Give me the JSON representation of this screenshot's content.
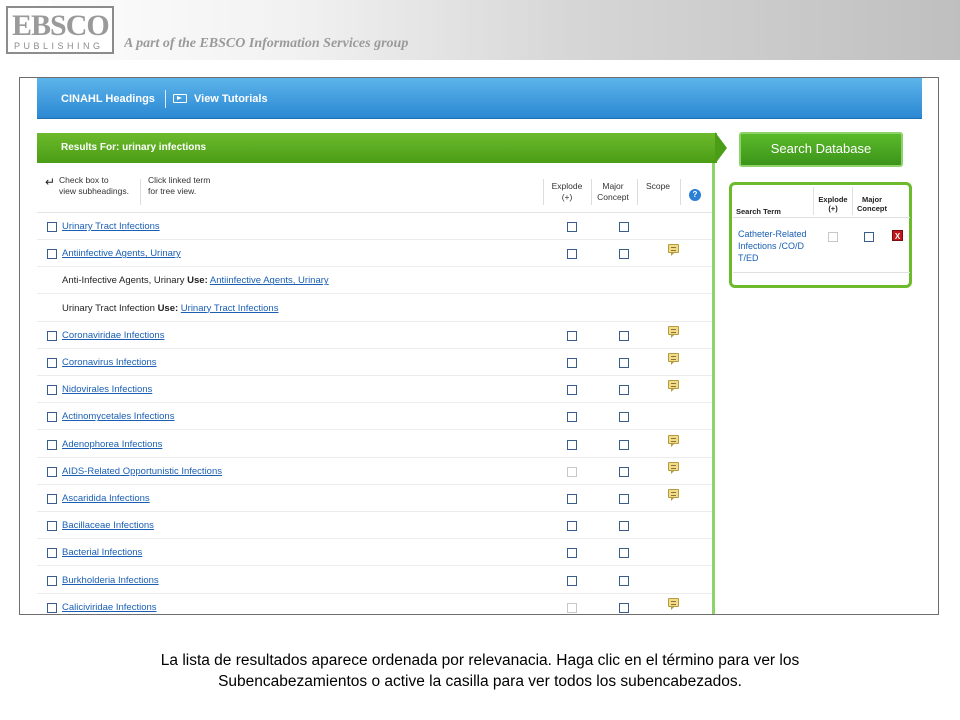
{
  "banner": {
    "logo_main": "EBSCO",
    "logo_sub": "PUBLISHING",
    "tagline": "A part of the EBSCO Information Services group"
  },
  "nav": {
    "headings": "CINAHL Headings",
    "tutorials": "View Tutorials"
  },
  "results": {
    "label": "Results For: urinary infections",
    "hint_checkbox": [
      "Check box to",
      "view subheadings."
    ],
    "hint_click": [
      "Click linked term",
      "for tree view."
    ],
    "col_explode": [
      "Explode",
      "(+)"
    ],
    "col_major": [
      "Major",
      "Concept"
    ],
    "col_scope": "Scope",
    "help": "?",
    "rows": [
      {
        "type": "term",
        "term": "Urinary Tract Infections",
        "scope": false,
        "explode_enabled": true
      },
      {
        "type": "term",
        "term": "Antiinfective Agents, Urinary",
        "scope": true,
        "explode_enabled": true
      },
      {
        "type": "use",
        "text": "Anti-Infective Agents, Urinary",
        "use_label": "Use:",
        "link": "Antiinfective Agents, Urinary"
      },
      {
        "type": "use",
        "text": "Urinary Tract Infection",
        "use_label": "Use:",
        "link": "Urinary Tract Infections"
      },
      {
        "type": "term",
        "term": "Coronaviridae Infections",
        "scope": true,
        "explode_enabled": true
      },
      {
        "type": "term",
        "term": "Coronavirus Infections",
        "scope": true,
        "explode_enabled": true
      },
      {
        "type": "term",
        "term": "Nidovirales Infections",
        "scope": true,
        "explode_enabled": true
      },
      {
        "type": "term",
        "term": "Actinomycetales Infections",
        "scope": false,
        "explode_enabled": true
      },
      {
        "type": "term",
        "term": "Adenophorea Infections",
        "scope": true,
        "explode_enabled": true
      },
      {
        "type": "term",
        "term": "AIDS-Related Opportunistic Infections",
        "scope": true,
        "explode_enabled": false
      },
      {
        "type": "term",
        "term": "Ascaridida Infections",
        "scope": true,
        "explode_enabled": true
      },
      {
        "type": "term",
        "term": "Bacillaceae Infections",
        "scope": false,
        "explode_enabled": true
      },
      {
        "type": "term",
        "term": "Bacterial Infections",
        "scope": false,
        "explode_enabled": true
      },
      {
        "type": "term",
        "term": "Burkholderia Infections",
        "scope": false,
        "explode_enabled": true
      },
      {
        "type": "term",
        "term": "Caliciviridae Infections",
        "scope": true,
        "explode_enabled": false
      }
    ]
  },
  "search_box": {
    "button": "Search Database",
    "head_term": "Search Term",
    "head_explode": [
      "Explode",
      "(+)"
    ],
    "head_major": [
      "Major",
      "Concept"
    ],
    "term_lines": [
      "Catheter-Related",
      "Infections /CO/D",
      "T/ED"
    ],
    "remove": "X"
  },
  "caption": {
    "line1": "La lista de resultados aparece ordenada por relevanacia. Haga clic en el término para ver los",
    "line2": "Subencabezamientos o active la casilla para ver todos los subencabezados."
  },
  "colors": {
    "nav_blue": "#2b88d3",
    "results_green": "#4a9d16",
    "link_blue": "#1a5fb4",
    "remove_red": "#c0181c"
  }
}
